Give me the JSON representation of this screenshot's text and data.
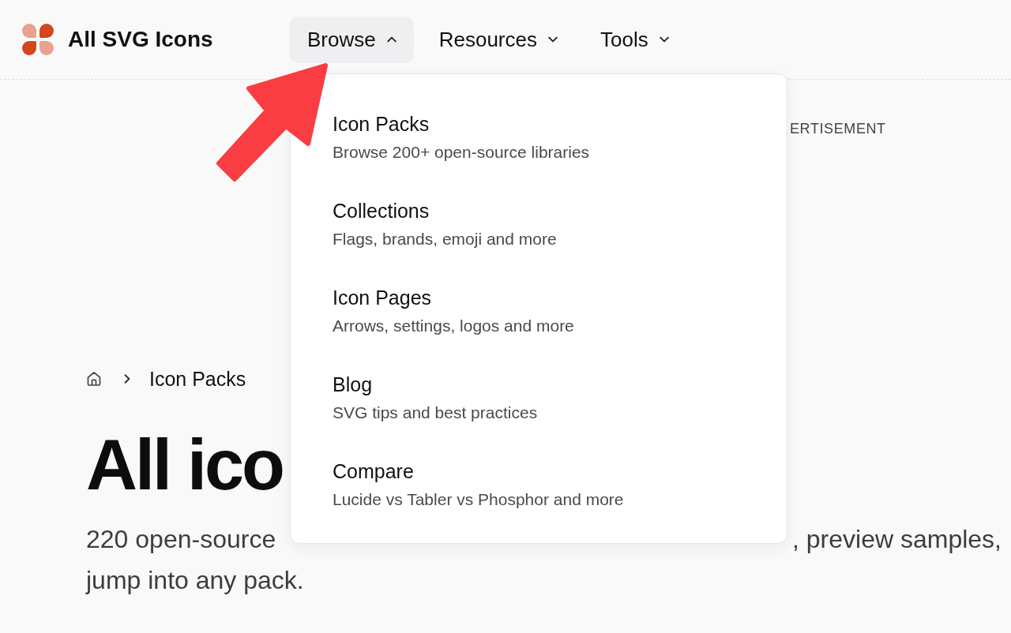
{
  "header": {
    "title": "All SVG Icons",
    "nav": [
      {
        "label": "Browse",
        "expanded": true,
        "menu": [
          {
            "title": "Icon Packs",
            "description": "Browse 200+ open-source libraries"
          },
          {
            "title": "Collections",
            "description": "Flags, brands, emoji and more"
          },
          {
            "title": "Icon Pages",
            "description": "Arrows, settings, logos and more"
          },
          {
            "title": "Blog",
            "description": "SVG tips and best practices"
          },
          {
            "title": "Compare",
            "description": "Lucide vs Tabler vs Phosphor and more"
          }
        ]
      },
      {
        "label": "Resources",
        "expanded": false
      },
      {
        "label": "Tools",
        "expanded": false
      }
    ]
  },
  "advertisement": {
    "label": "ERTISEMENT"
  },
  "breadcrumb": {
    "current": "Icon Packs"
  },
  "heading": "All ico",
  "intro": {
    "lines": [
      {
        "parts": [
          "220 open-source",
          ", preview samples,"
        ]
      },
      {
        "parts": [
          "jump into any pack."
        ]
      }
    ]
  }
}
